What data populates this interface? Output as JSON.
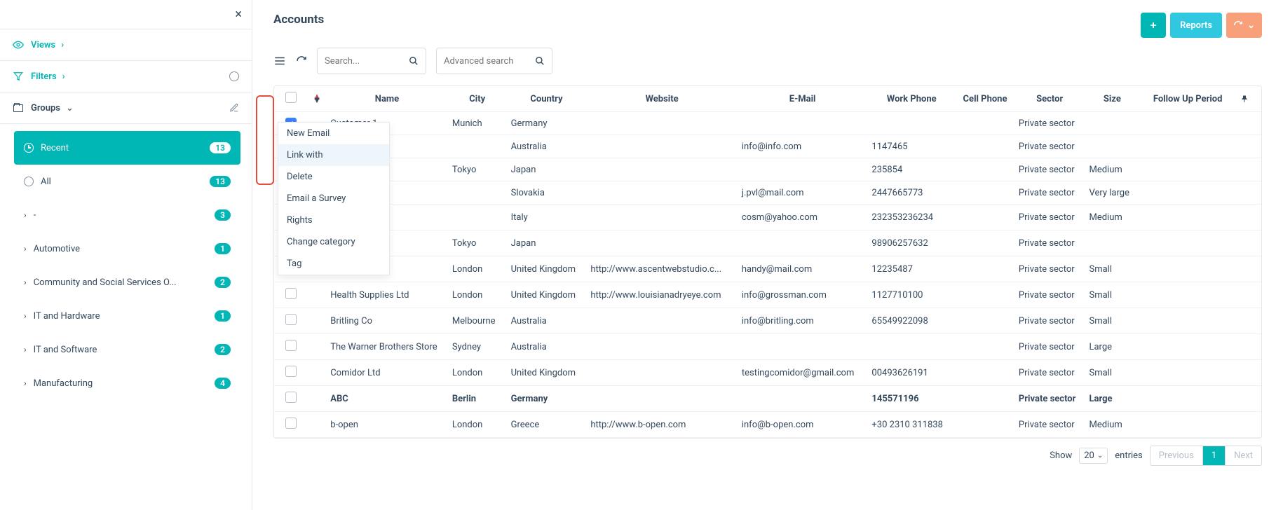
{
  "page_title": "Accounts",
  "sidebar": {
    "views_label": "Views",
    "filters_label": "Filters",
    "groups_label": "Groups",
    "items": [
      {
        "label": "Recent",
        "badge": "13",
        "active": true,
        "icon": "clock"
      },
      {
        "label": "All",
        "badge": "13",
        "icon": "radio"
      },
      {
        "label": "-",
        "badge": "3",
        "icon": "chevron"
      },
      {
        "label": "Automotive",
        "badge": "1",
        "icon": "chevron"
      },
      {
        "label": "Community and Social Services O...",
        "badge": "2",
        "icon": "chevron"
      },
      {
        "label": "IT and Hardware",
        "badge": "1",
        "icon": "chevron"
      },
      {
        "label": "IT and Software",
        "badge": "2",
        "icon": "chevron"
      },
      {
        "label": "Manufacturing",
        "badge": "4",
        "icon": "chevron"
      }
    ]
  },
  "actions": {
    "reports": "Reports"
  },
  "search": {
    "placeholder": "Search...",
    "adv_placeholder": "Advanced search"
  },
  "columns": [
    "Name",
    "City",
    "Country",
    "Website",
    "E-Mail",
    "Work Phone",
    "Cell Phone",
    "Sector",
    "Size",
    "Follow Up Period"
  ],
  "rows": [
    {
      "checked": true,
      "name": "Customer 1",
      "city": "Munich",
      "country": "Germany",
      "website": "",
      "email": "",
      "wphone": "",
      "cphone": "",
      "sector": "Private sector",
      "size": "",
      "follow": ""
    },
    {
      "checked": true,
      "name": "",
      "city": "",
      "country": "Australia",
      "website": "",
      "email": "info@info.com",
      "wphone": "1147465",
      "cphone": "",
      "sector": "Private sector",
      "size": "",
      "follow": ""
    },
    {
      "checked": true,
      "name": "",
      "city": "Tokyo",
      "country": "Japan",
      "website": "",
      "email": "",
      "wphone": "235854",
      "cphone": "",
      "sector": "Private sector",
      "size": "Medium",
      "follow": ""
    },
    {
      "checked": true,
      "name": "",
      "city": "",
      "country": "Slovakia",
      "website": "",
      "email": "j.pvl@mail.com",
      "wphone": "2447665773",
      "cphone": "",
      "sector": "Private sector",
      "size": "Very large",
      "follow": ""
    },
    {
      "checked": false,
      "name": "",
      "city": "",
      "country": "Italy",
      "website": "",
      "email": "cosm@yahoo.com",
      "wphone": "232353236234",
      "cphone": "",
      "sector": "Private sector",
      "size": "Medium",
      "follow": ""
    },
    {
      "checked": false,
      "name": "",
      "city": "Tokyo",
      "country": "Japan",
      "website": "",
      "email": "",
      "wphone": "98906257632",
      "cphone": "",
      "sector": "Private sector",
      "size": "",
      "follow": ""
    },
    {
      "checked": false,
      "name": "",
      "city": "London",
      "country": "United Kingdom",
      "website": "http://www.ascentwebstudio.c...",
      "email": "handy@mail.com",
      "wphone": "12235487",
      "cphone": "",
      "sector": "Private sector",
      "size": "Small",
      "follow": ""
    },
    {
      "checked": false,
      "name": "Health Supplies Ltd",
      "city": "London",
      "country": "United Kingdom",
      "website": "http://www.louisianadryeye.com",
      "email": "info@grossman.com",
      "wphone": "1127710100",
      "cphone": "",
      "sector": "Private sector",
      "size": "Small",
      "follow": ""
    },
    {
      "checked": false,
      "name": "Britling Co",
      "city": "Melbourne",
      "country": "Australia",
      "website": "",
      "email": "info@britling.com",
      "wphone": "65549922098",
      "cphone": "",
      "sector": "Private sector",
      "size": "Small",
      "follow": ""
    },
    {
      "checked": false,
      "name": "The Warner Brothers Store",
      "city": "Sydney",
      "country": "Australia",
      "website": "",
      "email": "",
      "wphone": "",
      "cphone": "",
      "sector": "Private sector",
      "size": "Large",
      "follow": ""
    },
    {
      "checked": false,
      "name": "Comidor Ltd",
      "city": "London",
      "country": "United Kingdom",
      "website": "",
      "email": "testingcomidor@gmail.com",
      "wphone": "00493626191",
      "cphone": "",
      "sector": "Private sector",
      "size": "Small",
      "follow": ""
    },
    {
      "checked": false,
      "bold": true,
      "name": "ABC",
      "city": "Berlin",
      "country": "Germany",
      "website": "",
      "email": "",
      "wphone": "145571196",
      "cphone": "",
      "sector": "Private sector",
      "size": "Large",
      "follow": ""
    },
    {
      "checked": false,
      "name": "b-open",
      "city": "London",
      "country": "Greece",
      "website": "http://www.b-open.com",
      "email": "info@b-open.com",
      "wphone": "+30 2310 311838",
      "cphone": "",
      "sector": "Private sector",
      "size": "Medium",
      "follow": ""
    }
  ],
  "context_menu": [
    "New Email",
    "Link with",
    "Delete",
    "Email a Survey",
    "Rights",
    "Change category",
    "Tag"
  ],
  "context_hover_index": 1,
  "footer": {
    "show": "Show",
    "entries": "entries",
    "page_size": "20",
    "prev": "Previous",
    "next": "Next",
    "current": "1"
  }
}
